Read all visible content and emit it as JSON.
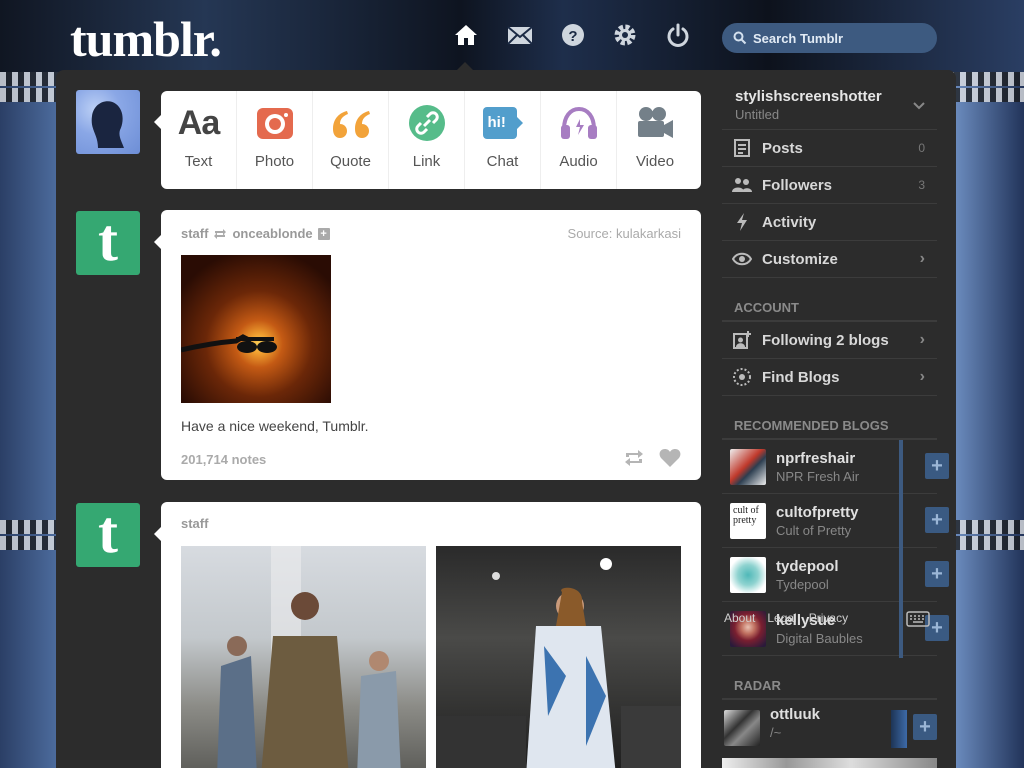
{
  "brand": {
    "logo": "tumblr."
  },
  "search": {
    "placeholder": "Search Tumblr"
  },
  "composer": {
    "types": [
      {
        "label": "Text",
        "color": "#444444"
      },
      {
        "label": "Photo",
        "color": "#e46a4e"
      },
      {
        "label": "Quote",
        "color": "#f2a33a"
      },
      {
        "label": "Link",
        "color": "#56bc8a"
      },
      {
        "label": "Chat",
        "color": "#529ecc"
      },
      {
        "label": "Audio",
        "color": "#a77dc2"
      },
      {
        "label": "Video",
        "color": "#748089"
      }
    ],
    "text_glyph": "Aa",
    "chat_glyph": "hi!"
  },
  "posts": [
    {
      "author": "staff",
      "reblogged_from": "onceablonde",
      "source_label": "Source:",
      "source": "kulakarkasi",
      "caption": "Have a nice weekend, Tumblr.",
      "notes": "201,714 notes"
    },
    {
      "author": "staff"
    }
  ],
  "sidebar": {
    "username": "stylishscreenshotter",
    "subtitle": "Untitled",
    "items": [
      {
        "label": "Posts",
        "count": "0"
      },
      {
        "label": "Followers",
        "count": "3"
      },
      {
        "label": "Activity"
      },
      {
        "label": "Customize"
      }
    ],
    "account_heading": "ACCOUNT",
    "account_items": [
      {
        "label": "Following 2 blogs"
      },
      {
        "label": "Find Blogs"
      }
    ],
    "recommended_heading": "RECOMMENDED BLOGS",
    "recommended": [
      {
        "name": "nprfreshair",
        "desc": "NPR Fresh Air"
      },
      {
        "name": "cultofpretty",
        "desc": "Cult of Pretty",
        "thumb_text": "cult of pretty"
      },
      {
        "name": "tydepool",
        "desc": "Tydepool"
      },
      {
        "name": "kellysue",
        "desc": "Digital Baubles"
      }
    ],
    "footer_links": [
      "About",
      "Legal",
      "Privacy"
    ],
    "radar_heading": "RADAR",
    "radar": {
      "name": "ottluuk",
      "desc": "/~"
    }
  },
  "colors": {
    "accent": "#3d5a80",
    "tumblr_green": "#35a872",
    "panel": "#2c2c2c"
  }
}
